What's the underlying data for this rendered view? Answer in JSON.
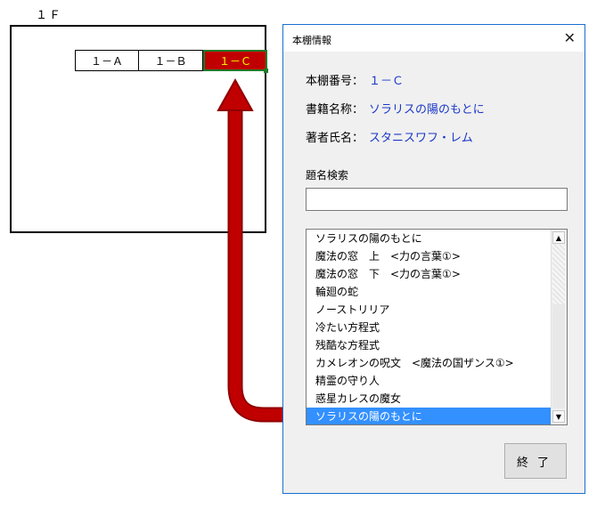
{
  "sheet": {
    "floor_label": "１Ｆ",
    "shelves": [
      "１－Ａ",
      "１－Ｂ",
      "１－Ｃ"
    ],
    "selected_shelf_color": "#c00000",
    "selected_shelf_text_color": "#ffff00",
    "arrow_color": "#c00000"
  },
  "dialog": {
    "title": "本棚情報",
    "close_glyph": "✕",
    "shelf_number_label": "本棚番号：",
    "shelf_number_value": "１－Ｃ",
    "book_name_label": "書籍名称：",
    "book_name_value": "ソラリスの陽のもとに",
    "author_label": "著者氏名：",
    "author_value": "スタニスワフ・レム",
    "search_label": "題名検索",
    "search_value": "",
    "list_items": [
      "ソラリスの陽のもとに",
      "魔法の窓　上　<力の言葉①>",
      "魔法の窓　下　<力の言葉①>",
      "輪廻の蛇",
      "ノーストリリア",
      "冷たい方程式",
      "残酷な方程式",
      "カメレオンの呪文　<魔法の国ザンス①>",
      "精霊の守り人",
      "惑星カレスの魔女",
      "ソラリスの陽のもとに"
    ],
    "selected_index": 10,
    "end_button_label": "終了"
  }
}
